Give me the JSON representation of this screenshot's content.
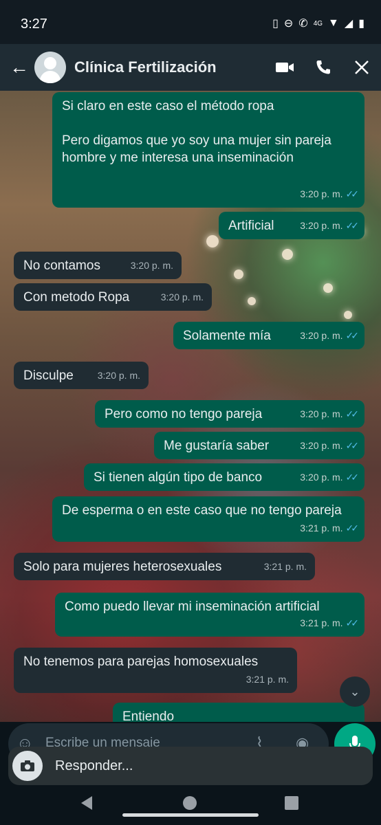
{
  "status_bar": {
    "time": "3:27",
    "network": "4G"
  },
  "header": {
    "contact_name": "Clínica Fertilización"
  },
  "messages": [
    {
      "dir": "out",
      "text": "Si claro en este caso el método ropa\n\nPero digamos que yo soy una mujer sin pareja hombre y me interesa una inseminación",
      "time": "3:20 p. m."
    },
    {
      "dir": "out",
      "text": "Artificial",
      "time": "3:20 p. m."
    },
    {
      "dir": "in",
      "text": "No contamos",
      "time": "3:20 p. m."
    },
    {
      "dir": "in",
      "text": "Con metodo Ropa",
      "time": "3:20 p. m."
    },
    {
      "dir": "out",
      "text": "Solamente mía",
      "time": "3:20 p. m."
    },
    {
      "dir": "in",
      "text": "Disculpe",
      "time": "3:20 p. m."
    },
    {
      "dir": "out",
      "text": "Pero como no tengo pareja",
      "time": "3:20 p. m."
    },
    {
      "dir": "out",
      "text": "Me gustaría saber",
      "time": "3:20 p. m."
    },
    {
      "dir": "out",
      "text": "Si tienen algún tipo de banco",
      "time": "3:20 p. m."
    },
    {
      "dir": "out",
      "text": "De esperma o en este caso que no tengo pareja",
      "time": "3:21 p. m."
    },
    {
      "dir": "in",
      "text": "Solo para mujeres heterosexuales",
      "time": "3:21 p. m."
    },
    {
      "dir": "out",
      "text": "Como puedo llevar mi inseminación artificial",
      "time": "3:21 p. m."
    },
    {
      "dir": "in",
      "text": "No tenemos para parejas homosexuales",
      "time": "3:21 p. m."
    },
    {
      "dir": "out",
      "text": "Entiendo",
      "time": ""
    }
  ],
  "composer": {
    "placeholder": "Escribe un mensaje"
  },
  "reply_notification": {
    "label": "Responder..."
  },
  "icons": {
    "back": "arrow-left-icon",
    "video_call": "video-call-icon",
    "voice_call": "phone-icon",
    "close": "close-icon",
    "emoji": "emoji-icon",
    "attach": "paperclip-icon",
    "camera": "camera-icon",
    "mic": "microphone-icon",
    "scroll_down": "double-chevron-down-icon"
  },
  "colors": {
    "header_bg": "#1f2c34",
    "outgoing_bubble": "#005c4b",
    "incoming_bubble": "#202c33",
    "read_ticks": "#53bdeb",
    "mic_button": "#00a884"
  }
}
